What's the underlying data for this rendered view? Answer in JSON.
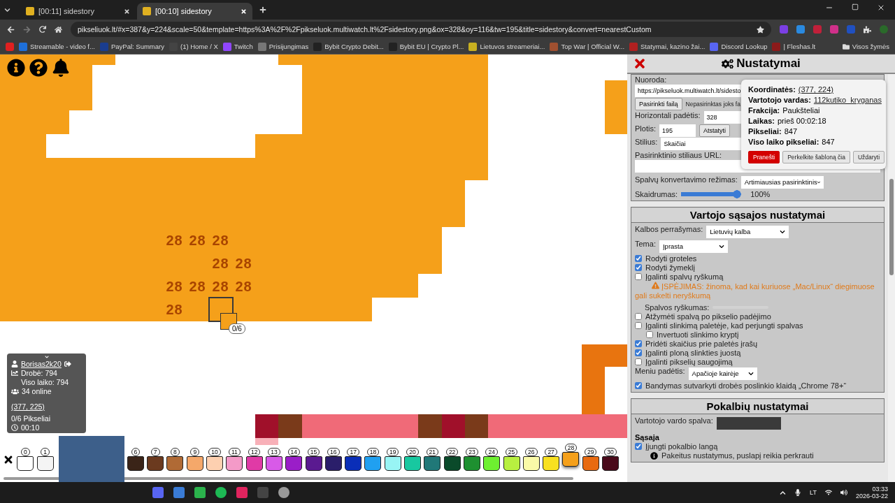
{
  "browser": {
    "tabs": [
      {
        "title": "[00:11] sidestory",
        "selected": false
      },
      {
        "title": "[00:10] sidestory",
        "selected": true
      }
    ],
    "url": "pikseliuok.lt/#x=387&y=224&scale=50&template=https%3A%2F%2Fpikseluok.multiwatch.lt%2Fsidestory.png&ox=328&oy=116&tw=195&title=sidestory&convert=nearestCustom",
    "bookmarks": [
      "Streamable - video f...",
      "PayPal: Summary",
      "(1) Home / X",
      "Twitch",
      "Prisijungimas",
      "Bybit Crypto Debit...",
      "Bybit EU | Crypto Pl...",
      "Lietuvos streameriai...",
      "Top War | Official W...",
      "Statymai, kazino žai...",
      "Discord Lookup",
      "| Fleshas.lt"
    ],
    "all_bookmarks": "Visos žymės"
  },
  "canvas": {
    "template_rows": [
      [
        "28",
        "28",
        "28",
        null
      ],
      [
        null,
        null,
        "28",
        "28"
      ],
      [
        "28",
        "28",
        "28",
        "28"
      ],
      [
        "28",
        null,
        null,
        null
      ]
    ],
    "cursor_counter": "0/6"
  },
  "info_panel": {
    "username": "Borisas2k20",
    "canvas_pixels": "Drobė: 794",
    "all_time_pixels": "Viso laiko: 794",
    "online": "34 online",
    "coordinates": "(377, 225)",
    "pixels": "0/6 Pikseliai",
    "timer": "00:10"
  },
  "palette": {
    "left": [
      {
        "label": "0",
        "color": "#ffffff",
        "selected": false
      },
      {
        "label": "1",
        "color": "#f4f4f4",
        "selected": false
      }
    ],
    "right": [
      {
        "label": "6",
        "color": "#3a2418",
        "selected": false
      },
      {
        "label": "7",
        "color": "#6b3a1f",
        "selected": false
      },
      {
        "label": "8",
        "color": "#b06a35",
        "selected": false
      },
      {
        "label": "9",
        "color": "#f5a86a",
        "selected": false
      },
      {
        "label": "10",
        "color": "#fdd0b0",
        "selected": false
      },
      {
        "label": "11",
        "color": "#f49ac8",
        "selected": false
      },
      {
        "label": "12",
        "color": "#e03aa6",
        "selected": false
      },
      {
        "label": "13",
        "color": "#d85ae8",
        "selected": false
      },
      {
        "label": "14",
        "color": "#9a1ec8",
        "selected": false
      },
      {
        "label": "15",
        "color": "#5a1a90",
        "selected": false
      },
      {
        "label": "16",
        "color": "#2a1e6a",
        "selected": false
      },
      {
        "label": "17",
        "color": "#0a2eb8",
        "selected": false
      },
      {
        "label": "18",
        "color": "#20a0f0",
        "selected": false
      },
      {
        "label": "19",
        "color": "#98f4f4",
        "selected": false
      },
      {
        "label": "20",
        "color": "#18c8a0",
        "selected": false
      },
      {
        "label": "21",
        "color": "#207878",
        "selected": false
      },
      {
        "label": "22",
        "color": "#0a4a2a",
        "selected": false
      },
      {
        "label": "23",
        "color": "#1e9030",
        "selected": false
      },
      {
        "label": "24",
        "color": "#6ef030",
        "selected": false
      },
      {
        "label": "25",
        "color": "#b8f040",
        "selected": false
      },
      {
        "label": "26",
        "color": "#fafaa8",
        "selected": false
      },
      {
        "label": "27",
        "color": "#f8e020",
        "selected": false
      },
      {
        "label": "28",
        "color": "#f5a01a",
        "selected": true
      },
      {
        "label": "29",
        "color": "#e86a10",
        "selected": false
      },
      {
        "label": "30",
        "color": "#4a0a1a",
        "selected": false
      }
    ]
  },
  "settings": {
    "title": "Nustatymai",
    "template_section": {
      "link_label": "Nuoroda:",
      "link_value": "https://pikseluok.multiwatch.lt/sidesto",
      "file_button": "Pasirinkti failą",
      "file_status": "Nepasirinktas joks fa",
      "x_label": "Horizontali padėtis:",
      "x_value": "328",
      "width_label": "Plotis:",
      "width_value": "195",
      "reset_button": "Atstatyti",
      "style_label": "Stilius:",
      "style_value": "Skaičiai",
      "custom_url_label": "Pasirinktinio stiliaus URL:",
      "convert_label": "Spalvų konvertavimo režimas:",
      "convert_value": "Artimiausias pasirinktinis",
      "opacity_label": "Skaidrumas:",
      "opacity": {
        "level": 1.0
      },
      "opacity_reading": "100%"
    },
    "ui_section": {
      "title": "Vartojo sąsajos nustatymai",
      "rows": [
        {
          "kind": "select",
          "label": "Kalbos perrašymas:",
          "value": "Lietuvių kalba"
        },
        {
          "kind": "select",
          "label": "Tema:",
          "value": "Įprasta"
        },
        {
          "kind": "checkbox",
          "label": "Rodyti groteles",
          "checked": true
        },
        {
          "kind": "checkbox",
          "label": "Rodyti žymeklį",
          "checked": true
        },
        {
          "kind": "checkbox",
          "label": "Įgalinti spalvų ryškumą",
          "checked": false
        },
        {
          "kind": "warning",
          "label": "ĮSPĖJIMAS: žinoma, kad kai kuriuose „Mac/Linux“ diegimuose gali sukelti neryškumą"
        },
        {
          "kind": "slider",
          "label": "Spalvos ryškumas:",
          "disabled": true
        },
        {
          "kind": "checkbox",
          "label": "Atžymėti spalvą po pikselio padėjimo",
          "checked": false
        },
        {
          "kind": "checkbox",
          "label": "Įgalinti slinkimą paletėje, kad perjungti spalvas",
          "checked": false,
          "children": [
            {
              "kind": "checkbox",
              "label": "Invertuoti slinkimo kryptį",
              "checked": false
            }
          ]
        },
        {
          "kind": "checkbox",
          "label": "Pridėti skaičius prie paletės įrašų",
          "checked": true
        },
        {
          "kind": "checkbox",
          "label": "Įgalinti ploną slinkties juostą",
          "checked": true
        },
        {
          "kind": "checkbox",
          "label": "Įgalinti pikselių saugojimą",
          "checked": false
        },
        {
          "kind": "select",
          "label": "Meniu padėtis:",
          "value": "Apačioje kairėje"
        },
        {
          "kind": "checkbox",
          "label": "Bandymas sutvarkyti drobės poslinkio klaidą „Chrome 78+“",
          "checked": true
        }
      ]
    },
    "chat_section": {
      "title": "Pokalbių nustatymai",
      "name_color_label": "Vartotojo vardo spalva:",
      "subheading": "Sąsaja",
      "rows": [
        {
          "kind": "checkbox",
          "label": "Įjungti pokalbio langą",
          "checked": true
        },
        {
          "kind": "note",
          "label": "Pakeitus nustatymus, puslapį reikia perkrauti"
        }
      ]
    }
  },
  "pixel_popup": {
    "fields": [
      {
        "kind": "link",
        "label": "Koordinatės:",
        "value": "(377, 224)"
      },
      {
        "kind": "link",
        "label": "Vartotojo vardas:",
        "value": "112kutiko_kryganas"
      },
      {
        "kind": "text",
        "label": "Frakcija:",
        "value": "Paukšteliai"
      },
      {
        "kind": "text",
        "label": "Laikas:",
        "value": "prieš 00:02:18"
      },
      {
        "kind": "text",
        "label": "Pikseliai:",
        "value": "847"
      },
      {
        "kind": "text",
        "label": "Viso laiko pikseliai:",
        "value": "847"
      }
    ],
    "buttons": [
      {
        "kind": "danger",
        "label": "Pranešti"
      },
      {
        "kind": "normal",
        "label": "Perkelkite šabloną čia"
      },
      {
        "kind": "normal",
        "label": "Uždaryti"
      }
    ]
  },
  "taskbar": {
    "language": "LT",
    "time": "03:33",
    "date": "2026-03-22"
  }
}
